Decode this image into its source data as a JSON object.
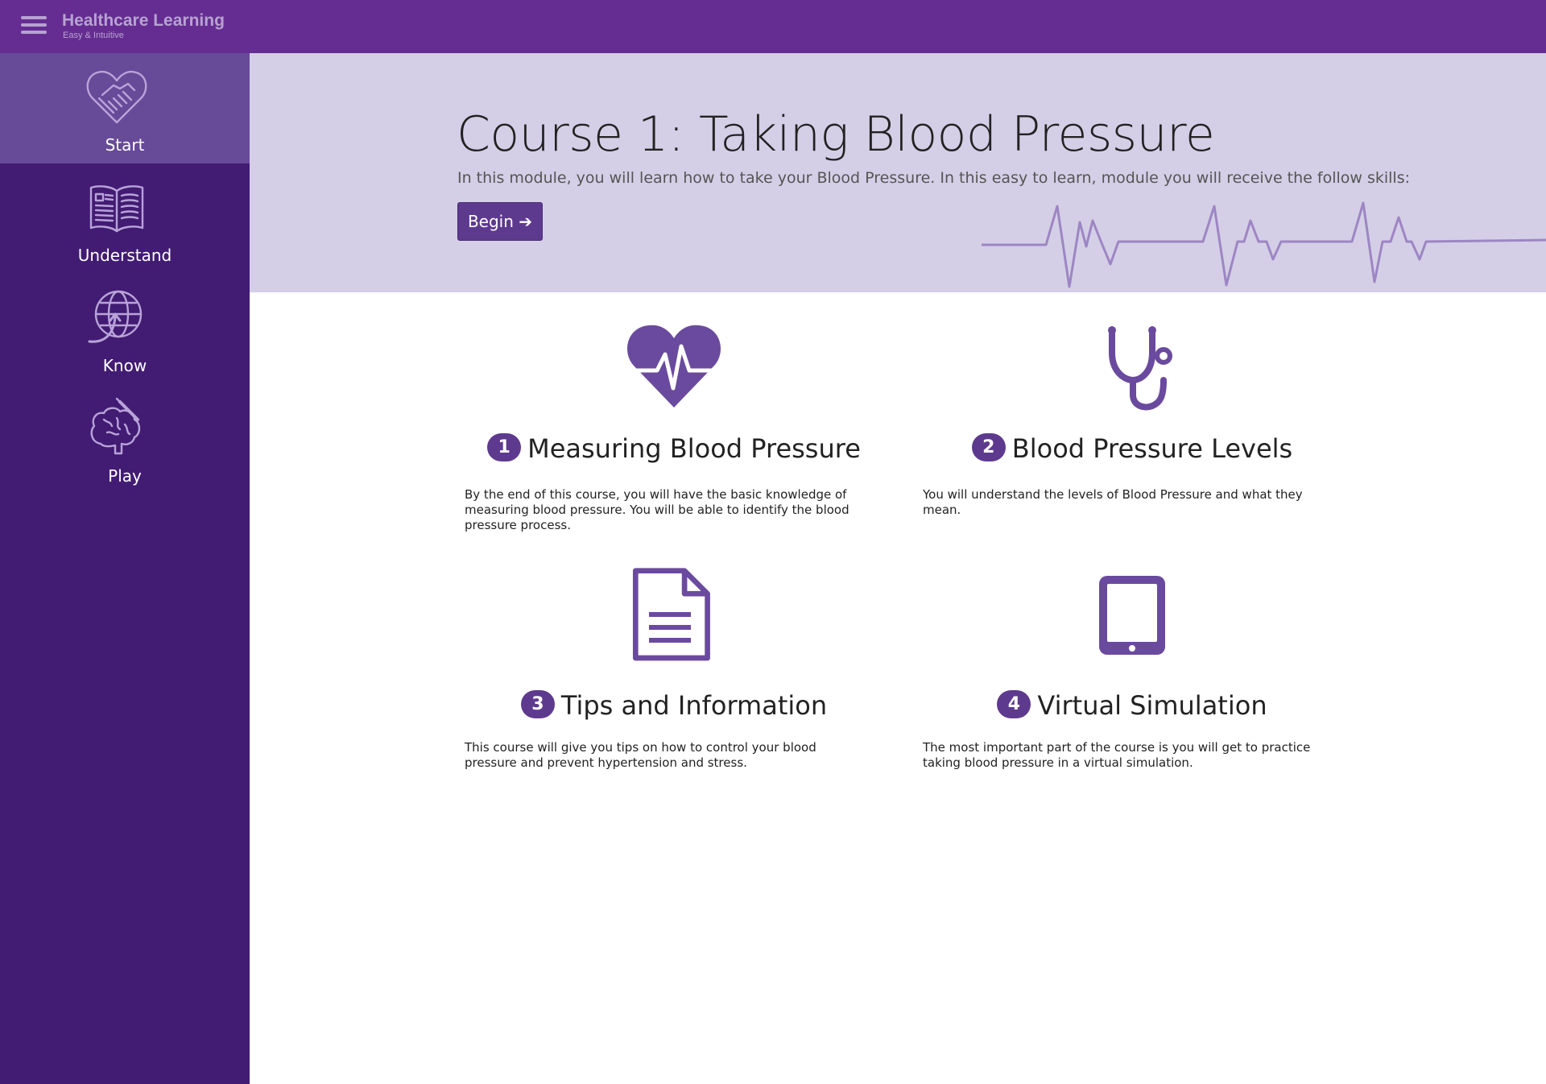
{
  "brand": {
    "title": "Healthcare Learning",
    "subtitle": "Easy & Intuitive"
  },
  "sidebar": {
    "items": [
      {
        "label": "Start",
        "icon": "handshake-heart-icon",
        "active": true
      },
      {
        "label": "Understand",
        "icon": "open-book-icon",
        "active": false
      },
      {
        "label": "Know",
        "icon": "globe-arrow-icon",
        "active": false
      },
      {
        "label": "Play",
        "icon": "brain-scalpel-icon",
        "active": false
      }
    ]
  },
  "hero": {
    "title": "Course 1: Taking Blood Pressure",
    "text": "In this module, you will learn how to take your Blood Pressure. In this easy to learn, module you will receive the follow skills:",
    "begin_label": "Begin"
  },
  "courses": [
    {
      "number": "1",
      "title": "Measuring Blood Pressure",
      "icon": "heart-pulse-icon",
      "description": "By the end of this course, you will have the basic knowledge of measuring blood pressure. You will be able to identify the blood pressure process."
    },
    {
      "number": "2",
      "title": "Blood Pressure Levels",
      "icon": "stethoscope-icon",
      "description": "You will understand the levels of Blood Pressure and what they mean."
    },
    {
      "number": "3",
      "title": "Tips and Information",
      "icon": "document-icon",
      "description": "This course will give you tips on how to control your blood pressure and prevent hypertension and stress."
    },
    {
      "number": "4",
      "title": "Virtual Simulation",
      "icon": "tablet-icon",
      "description": "The most important part of the course is you will get to practice taking blood pressure in a virtual simulation."
    }
  ],
  "colors": {
    "topbar": "#652d91",
    "sidebar": "#421c73",
    "sidebar_active": "#674a98",
    "hero_bg": "#d4cfe6",
    "accent": "#5e3a8f"
  }
}
